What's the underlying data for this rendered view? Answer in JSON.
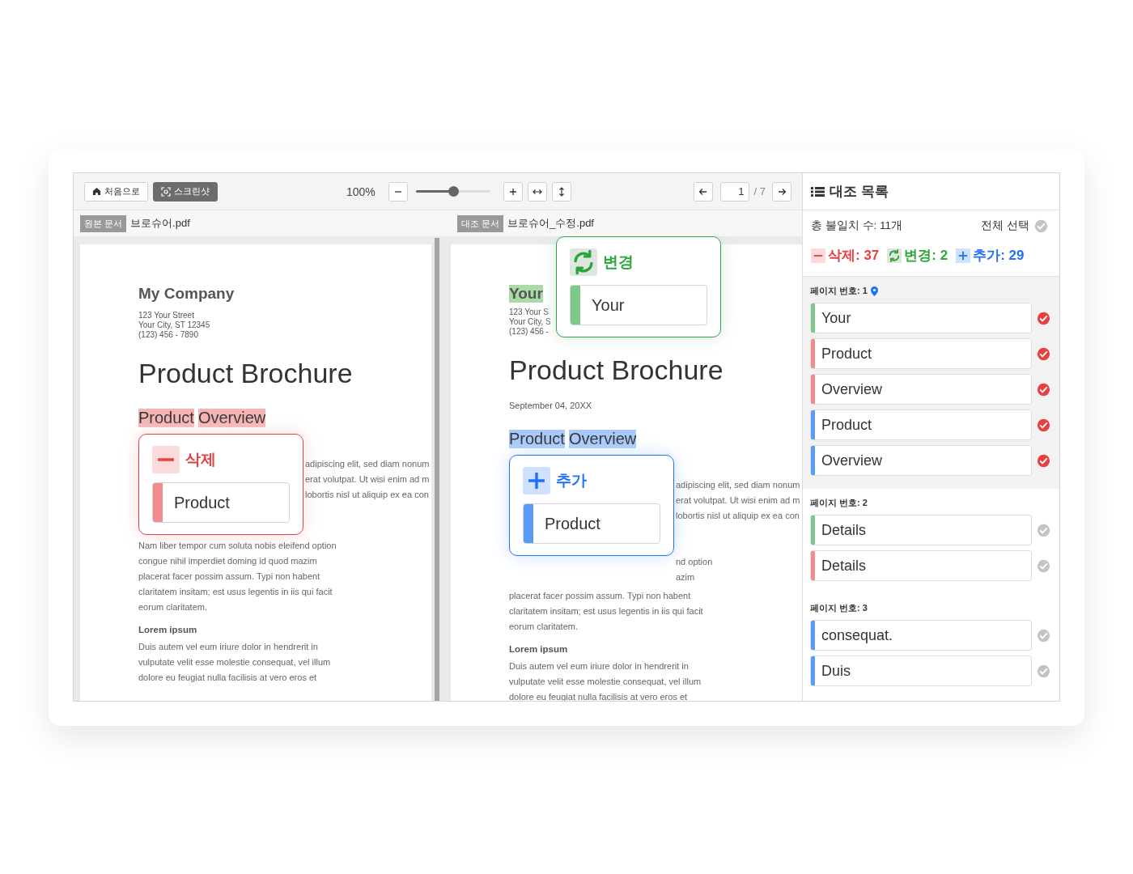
{
  "toolbar": {
    "home_button": "처음으로",
    "screenshot_button": "스크린샷",
    "zoom": "100%",
    "zoom_slider": {
      "level": 0.5
    },
    "page_input": "1",
    "page_total": "/ 7"
  },
  "documents": [
    {
      "tag": "원본 문서",
      "filename": "브로슈어.pdf",
      "header": {
        "kind": "company",
        "text": "My Company"
      },
      "address": [
        "123 Your Street",
        "Your City, ST 12345",
        "(123) 456 - 7890"
      ],
      "title": "Product Brochure",
      "overview": {
        "words": [
          "Product",
          "Overview"
        ],
        "kind": "deleted"
      },
      "popup": {
        "kind": "deleted",
        "label": "삭제",
        "word": "Product"
      },
      "side_lines": [
        "adipiscing elit, sed diam nonum",
        "erat volutpat. Ut wisi enim ad m",
        "lobortis nisl ut aliquip ex ea con"
      ],
      "body_lines": [
        "Nam liber tempor cum soluta nobis eleifend option",
        "congue nihil imperdiet doming id quod mazim",
        "placerat facer possim assum. Typi non habent",
        "claritatem insitam; est usus legentis in iis qui facit",
        "eorum claritatem."
      ],
      "subheading": "Lorem ipsum",
      "sub_lines": [
        "Duis autem vel eum iriure dolor in hendrerit in",
        "vulputate velit esse molestie consequat, vel illum",
        "dolore eu feugiat nulla facilisis at vero eros et"
      ]
    },
    {
      "tag": "대조 문서",
      "filename": "브로슈어_수정.pdf",
      "header": {
        "kind": "changed",
        "text": "Your"
      },
      "address": [
        "123 Your S",
        "Your City, S",
        "(123) 456 -"
      ],
      "title": "Product Brochure",
      "date": "September 04, 20XX",
      "overview": {
        "words": [
          "Product",
          "Overview"
        ],
        "kind": "added"
      },
      "top_popup": {
        "kind": "changed",
        "label": "변경",
        "word": "Your"
      },
      "popup": {
        "kind": "added",
        "label": "추가",
        "word": "Product"
      },
      "side_lines": [
        "adipiscing elit, sed diam nonum",
        "erat volutpat. Ut wisi enim ad m",
        "lobortis nisl ut aliquip ex ea con"
      ],
      "side_lines_2": [
        "nd option",
        "azim"
      ],
      "body_lines": [
        "placerat facer possim assum. Typi non habent",
        "claritatem insitam; est usus legentis in iis qui facit",
        "eorum claritatem."
      ],
      "subheading": "Lorem ipsum",
      "sub_lines": [
        "Duis autem vel eum iriure dolor in hendrerit in",
        "vulputate velit esse molestie consequat, vel illum",
        "dolore eu feugiat nulla facilisis at vero eros et"
      ]
    }
  ],
  "sidebar": {
    "title": "대조 목록",
    "total": "총 불일치 수: 11개",
    "select_all": {
      "label": "전체 선택",
      "checked": false
    },
    "counts": [
      {
        "kind": "deleted",
        "label": "삭제: 37"
      },
      {
        "kind": "changed",
        "label": "변경: 2"
      },
      {
        "kind": "added",
        "label": "추가: 29"
      }
    ],
    "groups": [
      {
        "label": "페이지 번호: 1",
        "selected": true,
        "items": [
          {
            "kind": "changed",
            "text": "Your",
            "checked": true
          },
          {
            "kind": "deleted",
            "text": "Product",
            "checked": true
          },
          {
            "kind": "deleted",
            "text": "Overview",
            "checked": true
          },
          {
            "kind": "added",
            "text": "Product",
            "checked": true
          },
          {
            "kind": "added",
            "text": "Overview",
            "checked": true
          }
        ]
      },
      {
        "label": "페이지 번호: 2",
        "selected": false,
        "items": [
          {
            "kind": "changed",
            "text": "Details",
            "checked": false
          },
          {
            "kind": "deleted",
            "text": "Details",
            "checked": false
          }
        ]
      },
      {
        "label": "페이지 번호: 3",
        "selected": false,
        "items": [
          {
            "kind": "added",
            "text": "consequat.",
            "checked": false
          },
          {
            "kind": "added",
            "text": "Duis",
            "checked": false
          }
        ]
      }
    ]
  }
}
